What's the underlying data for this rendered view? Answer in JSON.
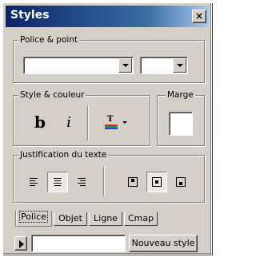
{
  "window": {
    "title": "Styles",
    "close_label": "×"
  },
  "police_point": {
    "legend": "Police & point",
    "font_value": "",
    "size_value": ""
  },
  "style_couleur": {
    "legend": "Style & couleur",
    "bold_label": "b",
    "italic_label": "i",
    "color_label": "T"
  },
  "marge": {
    "legend": "Marge"
  },
  "justification": {
    "legend": "Justification du texte"
  },
  "tabs": [
    {
      "label": "Police",
      "active": true
    },
    {
      "label": "Objet",
      "active": false
    },
    {
      "label": "Ligne",
      "active": false
    },
    {
      "label": "Cmap",
      "active": false
    }
  ],
  "bottom": {
    "style_name_value": "",
    "new_style_label": "Nouveau style"
  },
  "colors": {
    "title_start": "#0a246a",
    "title_end": "#a6caf0",
    "face": "#d4d0c8"
  }
}
